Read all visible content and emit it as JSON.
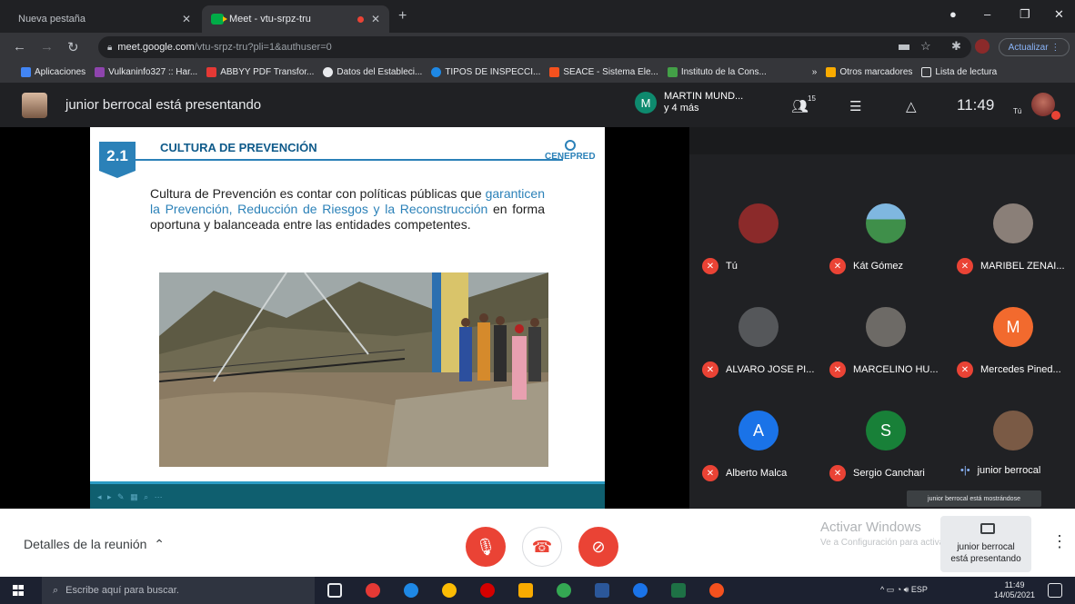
{
  "browser": {
    "tabs": [
      {
        "label": "Nueva pestaña",
        "active": false
      },
      {
        "label": "Meet - vtu-srpz-tru",
        "active": true
      }
    ],
    "url_host": "meet.google.com",
    "url_path": "/vtu-srpz-tru?pli=1&authuser=0",
    "update_label": "Actualizar",
    "bookmarks": [
      {
        "label": "Aplicaciones",
        "color": "#4285f4"
      },
      {
        "label": "Vulkaninfo327 :: Har...",
        "color": "#8e44ad"
      },
      {
        "label": "ABBYY PDF Transfor...",
        "color": "#e53935"
      },
      {
        "label": "Datos del Estableci...",
        "color": "#e8eaed"
      },
      {
        "label": "TIPOS DE INSPECCI...",
        "color": "#1e88e5"
      },
      {
        "label": "SEACE - Sistema Ele...",
        "color": "#f4511e"
      },
      {
        "label": "Instituto de la Cons...",
        "color": "#43a047"
      }
    ],
    "bookmarks_overflow": "»",
    "other_bookmarks": "Otros marcadores",
    "reading_list": "Lista de lectura"
  },
  "meet": {
    "presenting_banner": "junior berrocal está presentando",
    "pinned_initial": "M",
    "pinned_name": "MARTIN MUND...",
    "pinned_more": "y 4 más",
    "people_count": "15",
    "time": "11:49",
    "self_label": "Tú",
    "details_label": "Detalles de la reunión",
    "participants": [
      {
        "name": "Tú",
        "initial": "",
        "color": "#8b2a2a",
        "muted": true
      },
      {
        "name": "Kát Gómez",
        "initial": "",
        "color": "#3f8f4a",
        "muted": true
      },
      {
        "name": "MARIBEL ZENAI...",
        "initial": "",
        "color": "#8a7f78",
        "muted": true
      },
      {
        "name": "ALVARO JOSE PI...",
        "initial": "",
        "color": "#55575a",
        "muted": true
      },
      {
        "name": "MARCELINO HU...",
        "initial": "",
        "color": "#6d6a66",
        "muted": true
      },
      {
        "name": "Mercedes Pined...",
        "initial": "M",
        "color": "#f26a2e",
        "muted": true
      },
      {
        "name": "Alberto Malca",
        "initial": "A",
        "color": "#1a73e8",
        "muted": true
      },
      {
        "name": "Sergio Canchari",
        "initial": "S",
        "color": "#188038",
        "muted": true
      },
      {
        "name": "junior berrocal",
        "initial": "",
        "color": "#7a5a45",
        "muted": false
      }
    ],
    "tooltip": "junior berrocal está mostrándose",
    "present_card_text_1": "junior berrocal",
    "present_card_text_2": "está presentando",
    "activate_title": "Activar Windows",
    "activate_sub": "Ve a Configuración para activar Windows."
  },
  "slide": {
    "number": "2.1",
    "title": "CULTURA DE PREVENCIÓN",
    "logo_text": "CENEPRED",
    "body_1": "Cultura de Prevención es contar con políticas públicas que ",
    "body_highlight": "garanticen la Prevención, Reducción de Riesgos y la Reconstrucción",
    "body_2": " en forma oportuna y balanceada entre las entidades competentes."
  },
  "taskbar": {
    "search_placeholder": "Escribe aquí para buscar.",
    "lang": "ESP",
    "time": "11:49",
    "date": "14/05/2021"
  }
}
